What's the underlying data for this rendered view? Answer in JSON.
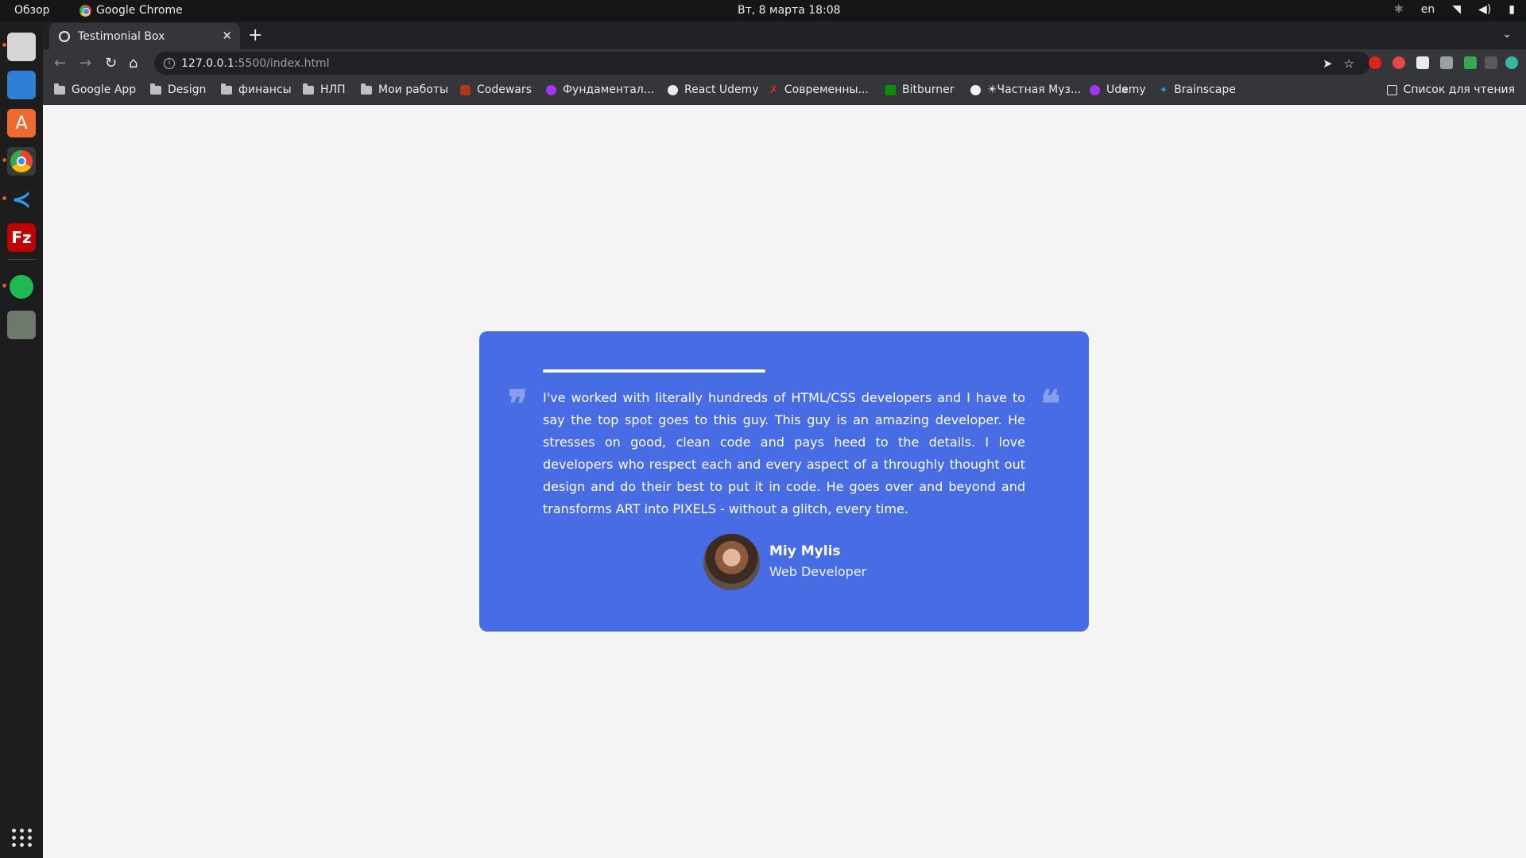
{
  "system": {
    "activities": "Обзор",
    "app_name": "Google Chrome",
    "clock": "Вт, 8 марта  18:08",
    "lang": "en"
  },
  "browser": {
    "tab_title": "Testimonial Box",
    "url_host": "127.0.0.1",
    "url_path": ":5500/index.html",
    "bookmarks": [
      {
        "label": "Google App",
        "icon": "folder-icon"
      },
      {
        "label": "Design",
        "icon": "folder-icon"
      },
      {
        "label": "финансы",
        "icon": "folder-icon"
      },
      {
        "label": "НЛП",
        "icon": "folder-icon"
      },
      {
        "label": "Мои работы",
        "icon": "folder-icon"
      },
      {
        "label": "Codewars",
        "icon": "codewars-icon",
        "color": "#b1361e"
      },
      {
        "label": "Фундаментал...",
        "icon": "udemy-icon",
        "color": "#a435f0"
      },
      {
        "label": "React Udemy",
        "icon": "globe-icon",
        "color": "#e8eaed"
      },
      {
        "label": "Современны...",
        "icon": "x-icon",
        "color": "#d93025"
      },
      {
        "label": "Bitburner",
        "icon": "bitburner-icon",
        "color": "#0a8f08"
      },
      {
        "label": "☀Частная Муз...",
        "icon": "music-icon",
        "color": "#f4f4f4"
      },
      {
        "label": "Udemy",
        "icon": "udemy-icon",
        "color": "#a435f0"
      },
      {
        "label": "Brainscape",
        "icon": "brainscape-icon",
        "color": "#2f9df0"
      }
    ],
    "reading_list": "Список для чтения",
    "more_bookmarks": "»"
  },
  "testimonial": {
    "text": "I've worked with literally hundreds of HTML/CSS developers and I have to say the top spot goes to this guy. This guy is an amazing developer. He stresses on good, clean code and pays heed to the details. I love developers who respect each and every aspect of a throughly thought out design and do their best to put it in code. He goes over and beyond and transforms ART into PIXELS - without a glitch, every time.",
    "author_name": "Miy Mylis",
    "author_role": "Web Developer",
    "open_quote": "❞",
    "close_quote": "❝",
    "accent": "#476ce4"
  }
}
